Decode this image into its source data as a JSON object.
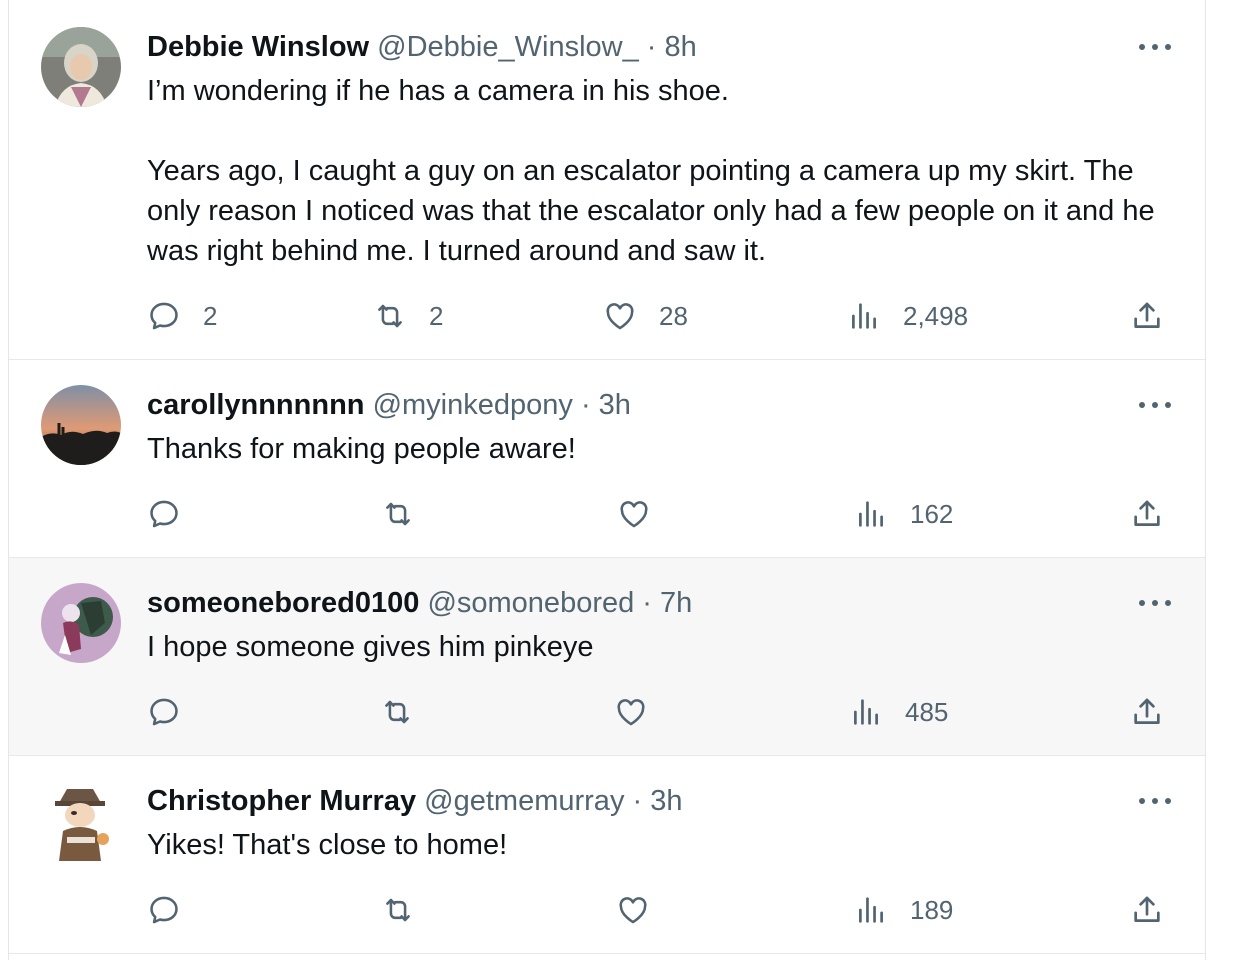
{
  "tweets": [
    {
      "name": "Debbie Winslow",
      "handle": "@Debbie_Winslow_",
      "separator": "·",
      "time": "8h",
      "text1": "I’m wondering if he has a camera in his shoe.",
      "text2": "Years ago, I caught a guy on an escalator pointing a camera up my skirt. The only reason I noticed was that the escalator only had a few people on it and he was right behind me. I turned around and saw it.",
      "replies": "2",
      "retweets": "2",
      "likes": "28",
      "views": "2,498"
    },
    {
      "name": "carollynnnnnnn",
      "handle": "@myinkedpony",
      "separator": "·",
      "time": "3h",
      "text1": "Thanks for making people aware!",
      "replies": "",
      "retweets": "",
      "likes": "",
      "views": "162"
    },
    {
      "name": "someonebored0100",
      "handle": "@somonebored",
      "separator": "·",
      "time": "7h",
      "text1": "I hope someone gives him pinkeye",
      "replies": "",
      "retweets": "",
      "likes": "",
      "views": "485"
    },
    {
      "name": "Christopher Murray",
      "handle": "@getmemurray",
      "separator": "·",
      "time": "3h",
      "text1": "Yikes! That's close to home!",
      "replies": "",
      "retweets": "",
      "likes": "",
      "views": "189"
    }
  ],
  "colors": {
    "text": "#0f1419",
    "secondary": "#536471",
    "highlight_bg": "#f7f7f7",
    "divider": "#e8e8e8"
  },
  "icons": [
    "reply-icon",
    "retweet-icon",
    "like-icon",
    "views-icon",
    "share-icon",
    "more-icon"
  ]
}
